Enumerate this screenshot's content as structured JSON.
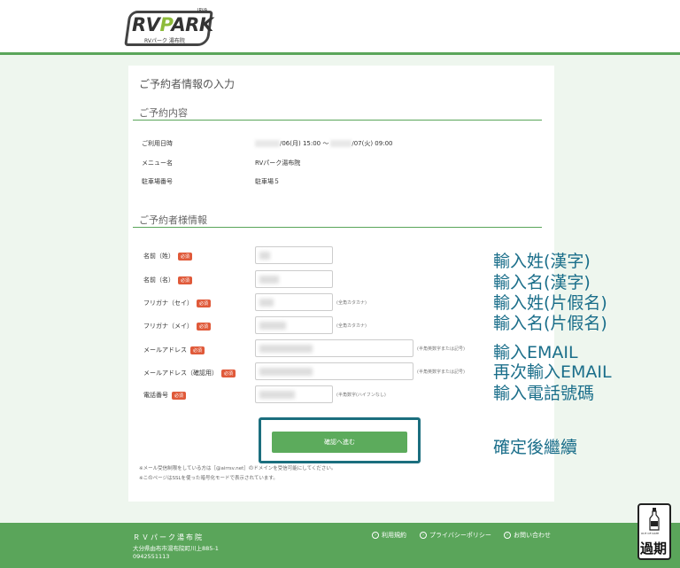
{
  "header": {
    "logo_text_a": "RV",
    "logo_text_b": "P",
    "logo_text_c": "ARK",
    "logo_sub": "RVパーク 湯布院",
    "logo_tag": "JRVA"
  },
  "page_title": "ご予約者情報の入力",
  "reservation": {
    "title": "ご予約内容",
    "rows": [
      {
        "label": "ご利用日時",
        "value_a": "/06(月) 15:00 ～",
        "value_b": "/07(火) 09:00"
      },
      {
        "label": "メニュー名",
        "value": "RVパーク湯布院"
      },
      {
        "label": "駐車場番号",
        "value": "駐車場５"
      }
    ]
  },
  "customer": {
    "title": "ご予約者様情報",
    "required_label": "必須",
    "fields": [
      {
        "label": "名前（姓）",
        "hint": ""
      },
      {
        "label": "名前（名）",
        "hint": ""
      },
      {
        "label": "フリガナ（セイ）",
        "hint": "(全角カタカナ)"
      },
      {
        "label": "フリガナ（メイ）",
        "hint": "(全角カタカナ)"
      },
      {
        "label": "メールアドレス",
        "hint": "(半角英数字または記号)"
      },
      {
        "label": "メールアドレス（確認用）",
        "hint": "(半角英数字または記号)"
      },
      {
        "label": "電話番号",
        "hint": "(半角数字(ハイフンなし)"
      }
    ]
  },
  "submit_label": "確認へ進む",
  "notes": [
    "※メール受信制限をしている方は［@airrsv.net］のドメインを受信可能にしてください。",
    "※このページはSSLを使った暗号化モードで表示されています。"
  ],
  "annotations": [
    "輸入姓(漢字)",
    "輸入名(漢字)",
    "輸入姓(片假名)",
    "輸入名(片假名)",
    "輸入EMAIL",
    "再次輸入EMAIL",
    "輸入電話號碼",
    "確定後繼續"
  ],
  "footer": {
    "name": "ＲＶパーク湯布院",
    "address": "大分県由布市湯布院町川上885-1",
    "tel": "0942551113",
    "links": [
      "利用規約",
      "プライバシーポリシー",
      "お問い合わせ"
    ]
  },
  "stamp": {
    "sub": "OUT OF DATE",
    "text": "過期"
  },
  "colors": {
    "accent": "#5aa55a",
    "annotation": "#1a6e8a",
    "frame": "#1b6e7e",
    "required": "#e05a3a"
  }
}
